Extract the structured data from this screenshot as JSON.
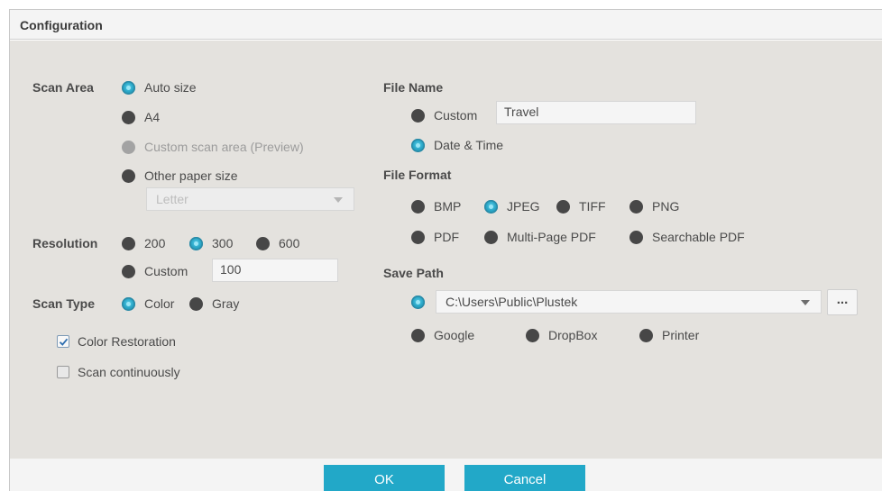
{
  "dialog": {
    "title": "Configuration"
  },
  "scan_area": {
    "label": "Scan Area",
    "options": [
      {
        "label": "Auto size",
        "checked": true,
        "disabled": false
      },
      {
        "label": "A4",
        "checked": false,
        "disabled": false
      },
      {
        "label": "Custom scan area (Preview)",
        "checked": false,
        "disabled": true
      },
      {
        "label": "Other paper size",
        "checked": false,
        "disabled": false
      }
    ],
    "paper_size_value": "Letter"
  },
  "resolution": {
    "label": "Resolution",
    "options": [
      {
        "label": "200",
        "checked": false
      },
      {
        "label": "300",
        "checked": true
      },
      {
        "label": "600",
        "checked": false
      },
      {
        "label": "Custom",
        "checked": false
      }
    ],
    "custom_value": "100"
  },
  "scan_type": {
    "label": "Scan Type",
    "options": [
      {
        "label": "Color",
        "checked": true
      },
      {
        "label": "Gray",
        "checked": false
      }
    ]
  },
  "checkboxes": {
    "color_restoration": {
      "label": "Color Restoration",
      "checked": true
    },
    "scan_continuously": {
      "label": "Scan continuously",
      "checked": false
    }
  },
  "file_name": {
    "label": "File Name",
    "custom_label": "Custom",
    "custom_value": "Travel",
    "datetime_label": "Date & Time",
    "selected": "Date & Time"
  },
  "file_format": {
    "label": "File Format",
    "options": [
      {
        "label": "BMP",
        "checked": false
      },
      {
        "label": "JPEG",
        "checked": true
      },
      {
        "label": "TIFF",
        "checked": false
      },
      {
        "label": "PNG",
        "checked": false
      },
      {
        "label": "PDF",
        "checked": false
      },
      {
        "label": "Multi-Page PDF",
        "checked": false
      },
      {
        "label": "Searchable PDF",
        "checked": false
      }
    ]
  },
  "save_path": {
    "label": "Save Path",
    "path_value": "C:\\Users\\Public\\Plustek",
    "browse_label": "...",
    "cloud_options": [
      {
        "label": "Google",
        "checked": false
      },
      {
        "label": "DropBox",
        "checked": false
      },
      {
        "label": "Printer",
        "checked": false
      }
    ]
  },
  "buttons": {
    "ok": "OK",
    "cancel": "Cancel"
  },
  "colors": {
    "accent": "#22a8c8",
    "panel_bg": "#e4e2de",
    "radio_off": "#474747"
  }
}
